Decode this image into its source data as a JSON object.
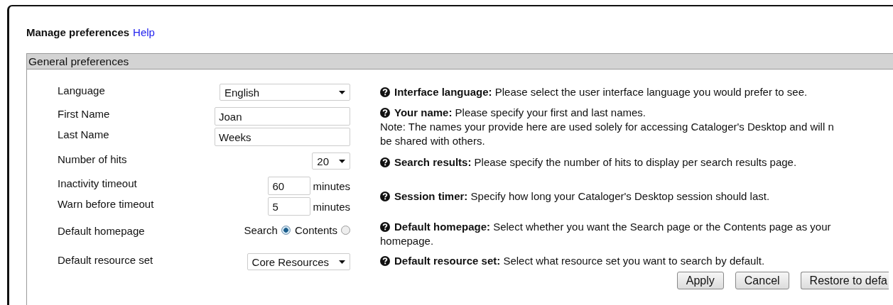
{
  "title": "Manage preferences",
  "help_link": "Help",
  "section": {
    "title": "General preferences"
  },
  "fields": [
    {
      "kind": "select",
      "label": "Language",
      "value": "English"
    },
    {
      "kind": "text",
      "label": "First Name",
      "value": "Joan"
    },
    {
      "kind": "text",
      "label": "Last Name",
      "value": "Weeks"
    },
    {
      "kind": "select",
      "label": "Number of hits",
      "value": "20"
    },
    {
      "kind": "number",
      "label": "Inactivity timeout",
      "value": "60",
      "unit": "minutes"
    },
    {
      "kind": "number",
      "label": "Warn before timeout",
      "value": "5",
      "unit": "minutes"
    },
    {
      "kind": "radio",
      "label": "Default homepage",
      "options": [
        {
          "label": "Search",
          "selected": true
        },
        {
          "label": "Contents",
          "selected": false
        }
      ]
    },
    {
      "kind": "select",
      "label": "Default resource set",
      "value": "Core Resources"
    }
  ],
  "help": [
    {
      "term": "Interface language:",
      "lines": [
        "Please select the user interface language you would prefer to see."
      ]
    },
    {
      "term": "Your name:",
      "lines": [
        "Please specify your first and last names."
      ],
      "note": [
        "Note: The names your provide here are used solely for accessing Cataloger's Desktop and will n",
        "be shared with others."
      ]
    },
    {
      "term": "Search results:",
      "lines": [
        "Please specify the number of hits to display per search results page."
      ]
    },
    {
      "term": "Session timer:",
      "lines": [
        "Specify how long your Cataloger's Desktop session should last."
      ]
    },
    {
      "term": "Default homepage:",
      "lines": [
        "Select whether you want the Search page or the Contents page as your",
        "homepage."
      ]
    },
    {
      "term": "Default resource set:",
      "lines": [
        "Select what resource set you want to search by default."
      ]
    }
  ],
  "buttons": [
    "Apply",
    "Cancel",
    "Restore to defa"
  ]
}
